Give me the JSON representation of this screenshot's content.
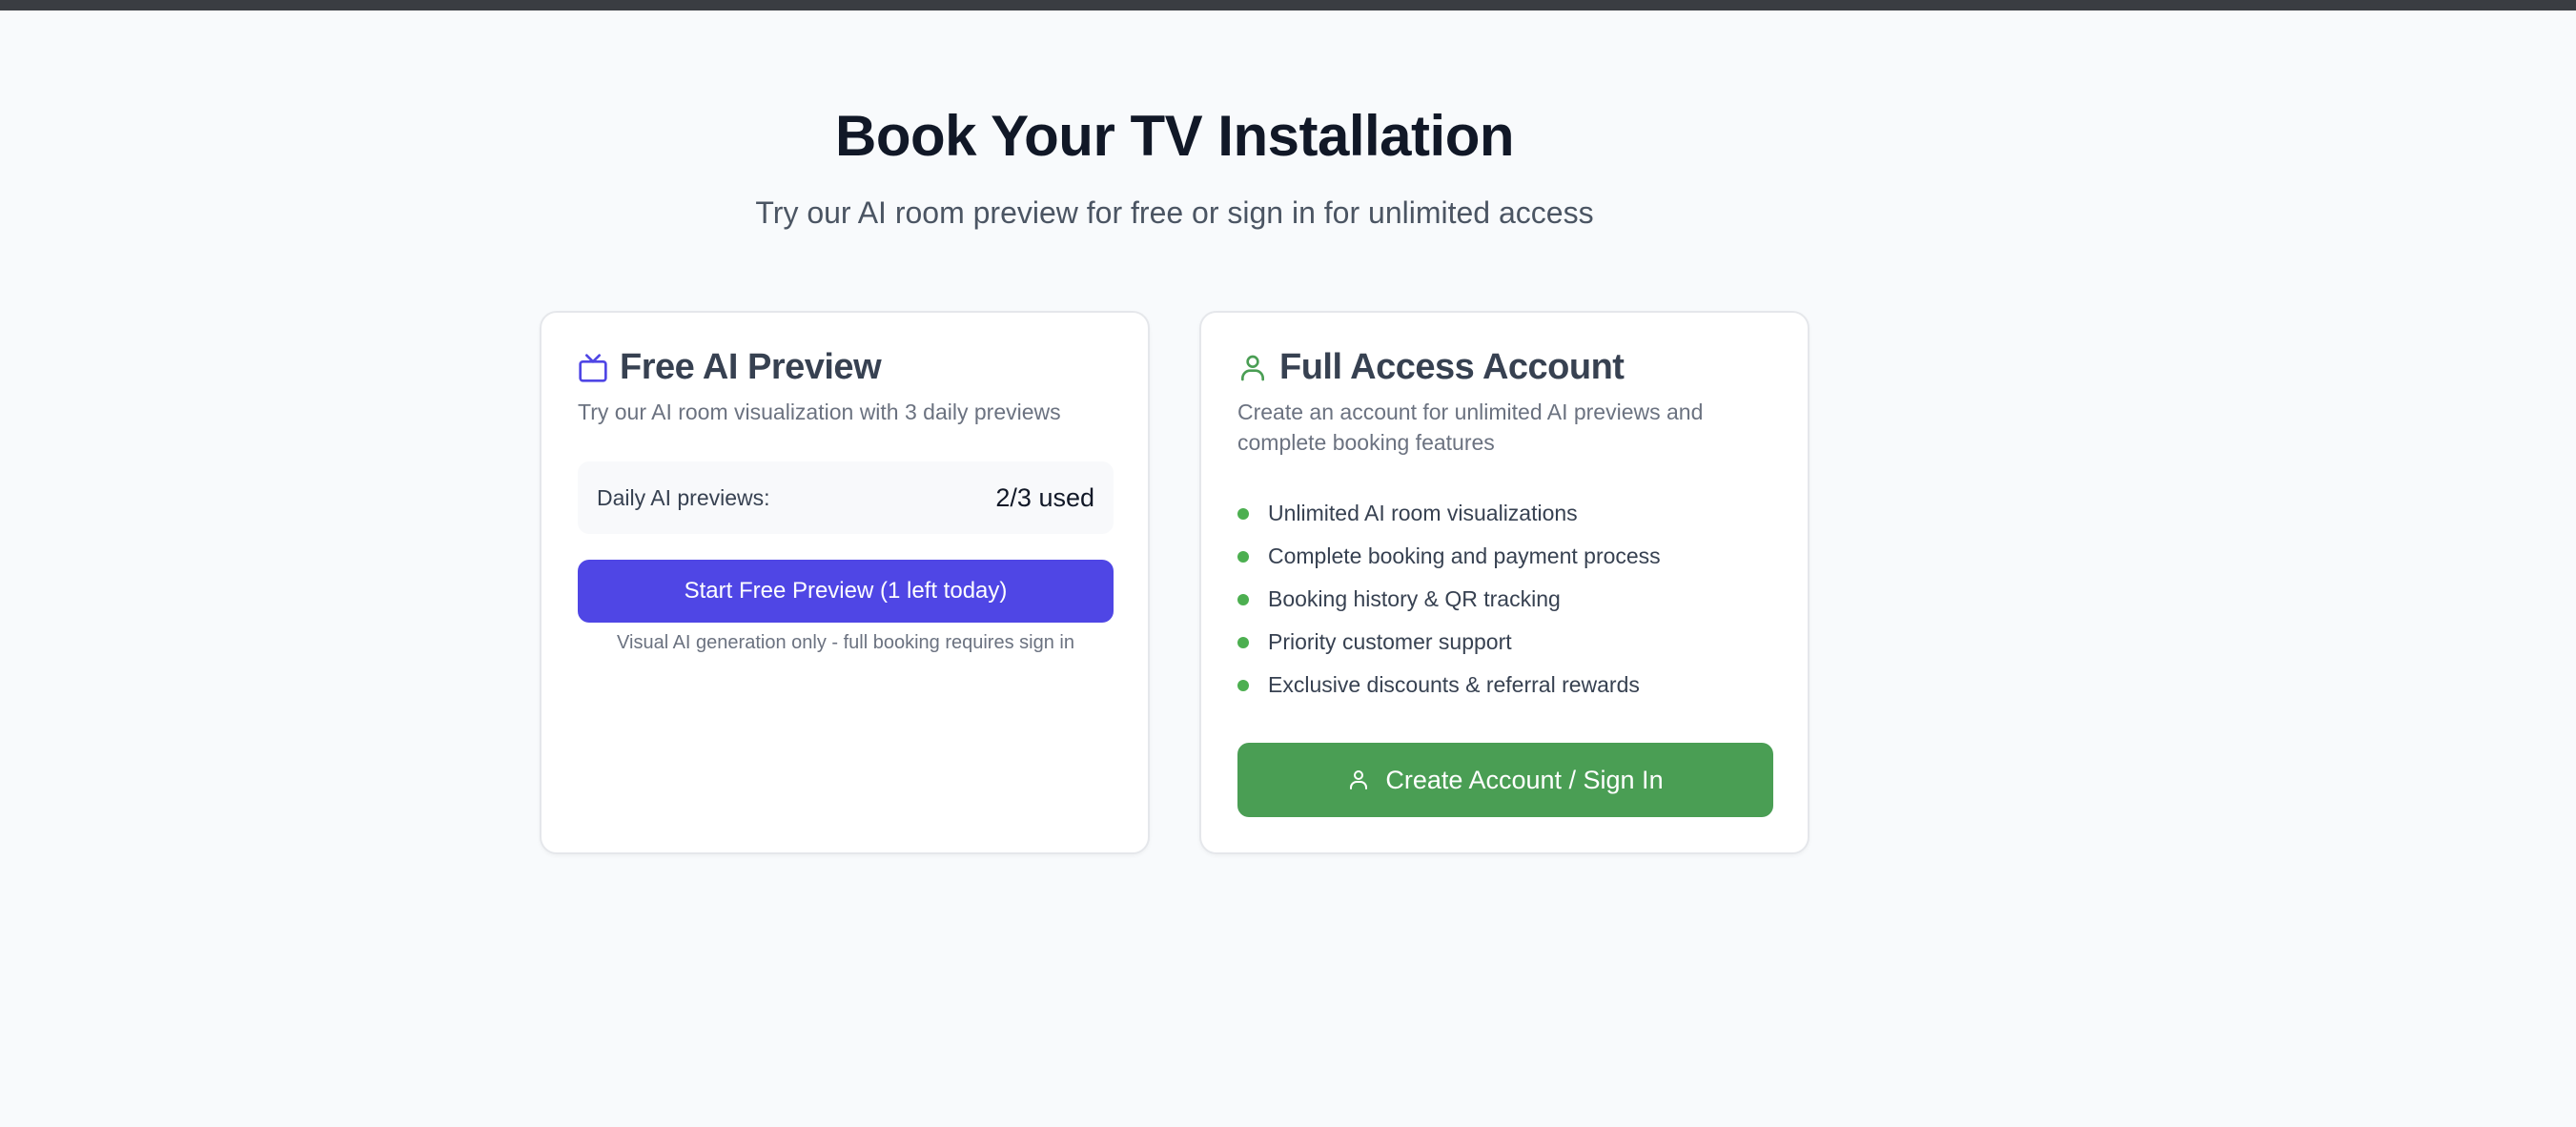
{
  "header": {
    "title": "Book Your TV Installation",
    "subtitle": "Try our AI room preview for free or sign in for unlimited access"
  },
  "free_card": {
    "icon": "tv-icon",
    "title": "Free AI Preview",
    "description": "Try our AI room visualization with 3 daily previews",
    "usage_label": "Daily AI previews:",
    "usage_value": "2/3 used",
    "button_label": "Start Free Preview (1 left today)",
    "note": "Visual AI generation only - full booking requires sign in",
    "accent_color": "#4f46e5"
  },
  "full_card": {
    "icon": "user-icon",
    "title": "Full Access Account",
    "description": "Create an account for unlimited AI previews and complete booking features",
    "features": [
      "Unlimited AI room visualizations",
      "Complete booking and payment process",
      "Booking history & QR tracking",
      "Priority customer support",
      "Exclusive discounts & referral rewards"
    ],
    "button_label": "Create Account / Sign In",
    "accent_color": "#4a9e54"
  }
}
